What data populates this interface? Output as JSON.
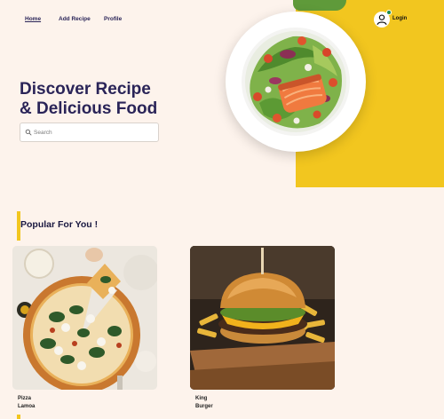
{
  "nav": {
    "items": [
      {
        "label": "Home",
        "active": true
      },
      {
        "label": "Add Recipe",
        "active": false
      },
      {
        "label": "Profile",
        "active": false
      }
    ]
  },
  "header": {
    "login_label": "Login",
    "user_icon": "user-icon",
    "status_color": "#1a8a4a"
  },
  "hero": {
    "title_line1": "Discover Recipe",
    "title_line2": "& Delicious Food",
    "search_placeholder": "Search",
    "accent_color": "#f2c61f",
    "title_color": "#2a2458"
  },
  "popular": {
    "title": "Popular For You !",
    "cards": [
      {
        "line1": "Pizza",
        "line2": "Lamoa"
      },
      {
        "line1": "King",
        "line2": "Burger"
      }
    ]
  }
}
